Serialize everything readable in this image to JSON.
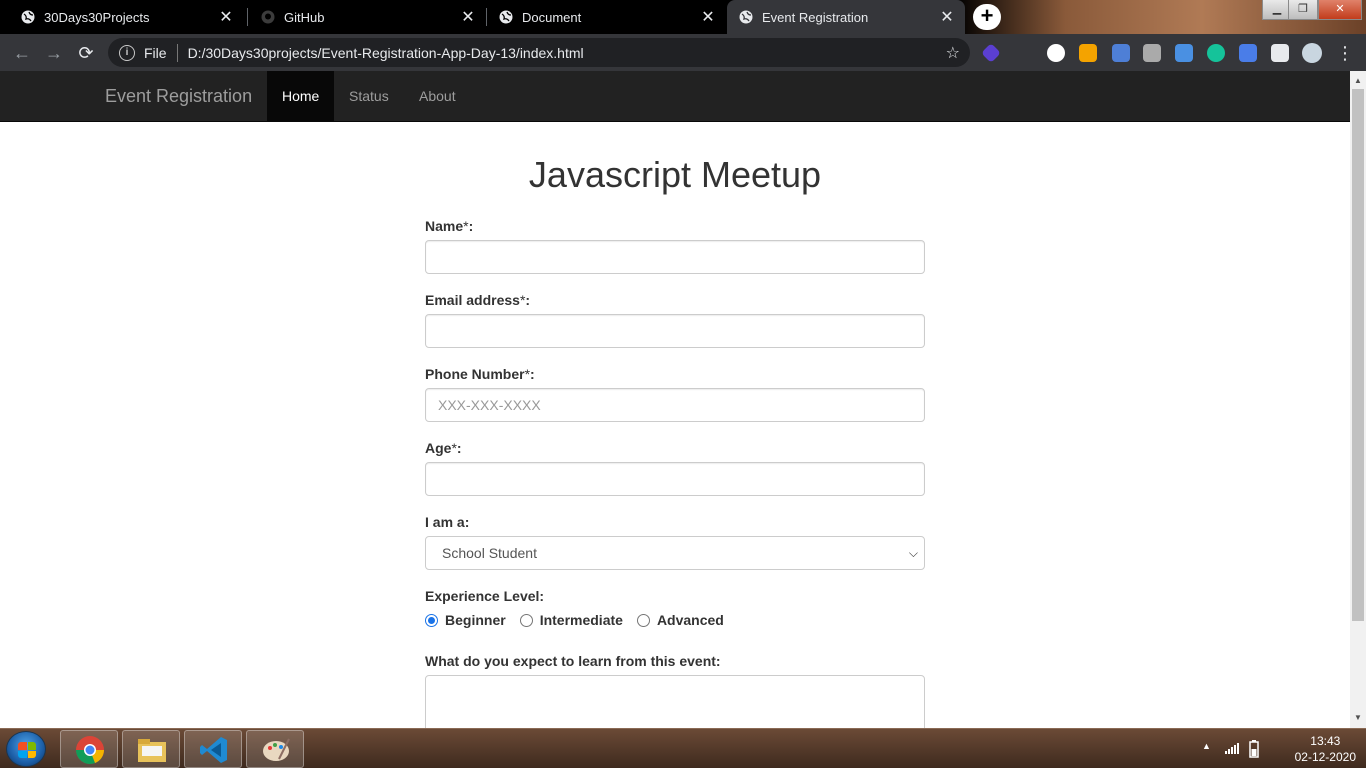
{
  "browser": {
    "tabs": [
      {
        "title": "30Days30Projects",
        "icon": "globe-icon",
        "active": false
      },
      {
        "title": "GitHub",
        "icon": "github-icon",
        "active": false
      },
      {
        "title": "Document",
        "icon": "globe-icon",
        "active": false
      },
      {
        "title": "Event Registration",
        "icon": "globe-icon",
        "active": true
      }
    ],
    "new_tab": "+",
    "address": {
      "scheme": "File",
      "url": "D:/30Days30projects/Event-Registration-App-Day-13/index.html"
    }
  },
  "site": {
    "brand": "Event Registration",
    "nav": [
      "Home",
      "Status",
      "About"
    ]
  },
  "form": {
    "title": "Javascript Meetup",
    "name_label": "Name",
    "email_label": "Email address",
    "phone_label": "Phone Number",
    "phone_placeholder": "XXX-XXX-XXXX",
    "age_label": "Age",
    "req_mark": "*",
    "colon": ":",
    "iam_label": "I am a:",
    "iam_selected": "School Student",
    "experience_label": "Experience Level:",
    "experience_options": [
      "Beginner",
      "Intermediate",
      "Advanced"
    ],
    "experience_selected": "Beginner",
    "expect_label": "What do you expect to learn from this event:"
  },
  "taskbar": {
    "time": "13:43",
    "date": "02-12-2020"
  },
  "colors": {
    "navbar_bg": "#222222",
    "nav_active_bg": "#080808",
    "radio_accent": "#1a73e8"
  }
}
